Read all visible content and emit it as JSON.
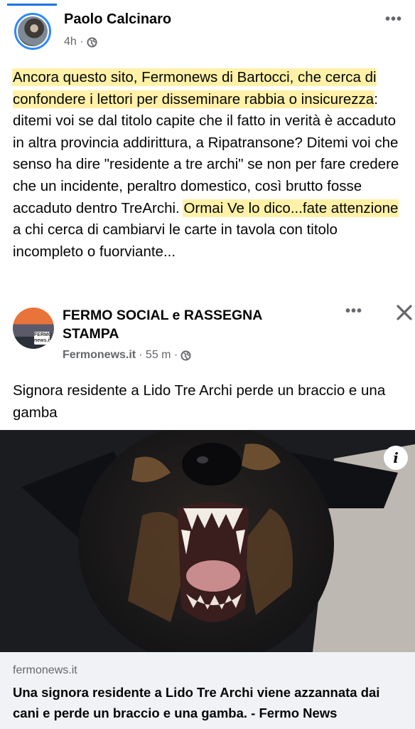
{
  "post": {
    "author": "Paolo Calcinaro",
    "time": "4h ·",
    "more_label": "•••",
    "text_parts": [
      "Ancora questo sito, Fermonews di Bartocci, che cerca di confondere i lettori per disseminare rabbia o insicurezza",
      ": ditemi voi se dal titolo capite che il fatto in verità è accaduto in altra provincia addirittura, a Ripatransone? Ditemi voi che senso ha dire \"residente a tre archi\" se non per fare credere che un incidente, peraltro domestico, così brutto fosse accaduto dentro TreArchi. ",
      "Ormai Ve lo dico...fate attenzione",
      " a chi cerca di cambiarvi le carte in tavola con titolo incompleto o fuorviante..."
    ],
    "highlight_color": "#fff1a8"
  },
  "shared": {
    "page_name": "FERMO SOCIAL e RASSEGNA STAMPA",
    "avatar_logo_text": "FERMO news.it",
    "source": "Fermonews.it",
    "time": "· 55 m ·",
    "more_label": "•••",
    "text": "Signora residente a Lido Tre Archi perde un braccio e una gamba"
  },
  "image": {
    "info_label": "i",
    "description_icon": "info-icon"
  },
  "link": {
    "domain": "fermonews.it",
    "title": "Una signora residente a Lido Tre Archi viene azzannata dai cani e perde un braccio e una gamba. - Fermo News"
  },
  "colors": {
    "accent": "#1b74e4",
    "secondary_text": "#65676b",
    "link_bg": "#f0f2f5"
  }
}
